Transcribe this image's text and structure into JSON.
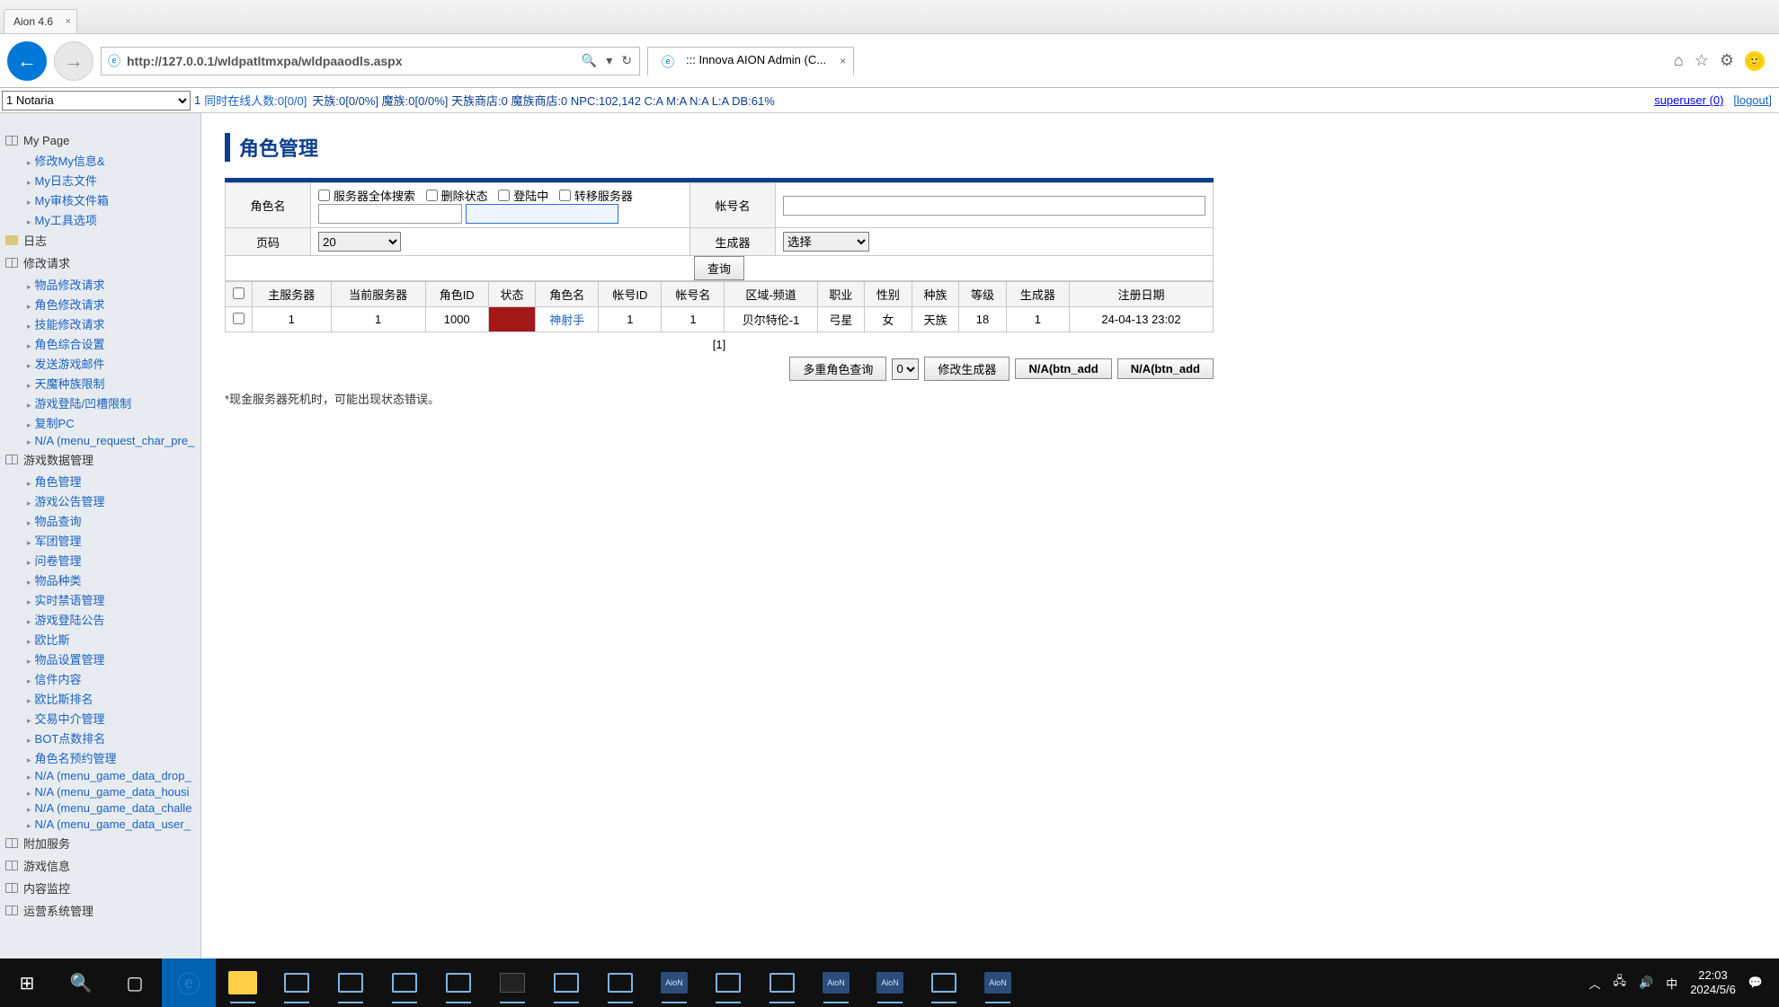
{
  "window": {
    "tab_title": "Aion 4.6"
  },
  "ie": {
    "address": "http://127.0.0.1/wldpatltmxpa/wldpaaodls.aspx",
    "tab_title": "::: Innova AION Admin (C..."
  },
  "status": {
    "server_selected": "1 Notaria",
    "num_before": "1",
    "online_label": "同时在线人数:0[0/0]",
    "rest": "天族:0[0/0%] 魔族:0[0/0%] 天族商店:0 魔族商店:0 NPC:102,142 C:A M:A N:A L:A DB:61%",
    "user": "superuser (0)",
    "logout": "[logout]"
  },
  "sidebar": {
    "sec_mypage": "My Page",
    "mypage": [
      "修改My信息&",
      "My日志文件",
      "My审核文件箱",
      "My工具选项"
    ],
    "sec_log": "日志",
    "sec_modify": "修改请求",
    "modify": [
      "物品修改请求",
      "角色修改请求",
      "技能修改请求",
      "角色综合设置",
      "发送游戏邮件",
      "天魔种族限制",
      "游戏登陆/凹槽限制",
      "复制PC",
      "N/A (menu_request_char_pre_"
    ],
    "sec_game": "游戏数据管理",
    "game": [
      "角色管理",
      "游戏公告管理",
      "物品查询",
      "军团管理",
      "问卷管理",
      "物品种类",
      "实时禁语管理",
      "游戏登陆公告",
      "欧比斯",
      "物品设置管理",
      "信件内容",
      "欧比斯排名",
      "交易中介管理",
      "BOT点数排名",
      "角色名预约管理",
      "N/A (menu_game_data_drop_",
      "N/A (menu_game_data_housi",
      "N/A (menu_game_data_challe",
      "N/A (menu_game_data_user_"
    ],
    "sec_addon": "附加服务",
    "sec_info": "游戏信息",
    "sec_monitor": "内容监控",
    "sec_ops": "运营系统管理"
  },
  "page": {
    "title": "角色管理",
    "filters": {
      "role_name": "角色名",
      "cb_all_servers": "服务器全体搜索",
      "cb_del_state": "删除状态",
      "cb_logging_in": "登陆中",
      "cb_transfer": "转移服务器",
      "account_name": "帐号名",
      "page_size_label": "页码",
      "page_size_value": "20",
      "generator_label": "生成器",
      "generator_value": "选择",
      "query_btn": "查询"
    },
    "table": {
      "headers": [
        "",
        "主服务器",
        "当前服务器",
        "角色ID",
        "状态",
        "角色名",
        "帐号ID",
        "帐号名",
        "区域-频道",
        "职业",
        "性别",
        "种族",
        "等级",
        "生成器",
        "注册日期"
      ],
      "row": {
        "main_server": "1",
        "cur_server": "1",
        "role_id": "1000",
        "role_name": "神射手",
        "acct_id": "1",
        "acct_name": "1",
        "zone": "贝尔特伦-1",
        "job": "弓星",
        "sex": "女",
        "race": "天族",
        "level": "18",
        "gen": "1",
        "reg": "24-04-13 23:02"
      }
    },
    "pager": "[1]",
    "actions": {
      "multi_query": "多重角色查询",
      "dd_value": "0",
      "mod_gen": "修改生成器",
      "btn_add1": "N/A(btn_add",
      "btn_add2": "N/A(btn_add"
    },
    "note": "*现金服务器死机时，可能出现状态错误。"
  },
  "taskbar": {
    "time": "22:03",
    "date": "2024/5/6",
    "ime": "中",
    "aion_label": "AioN"
  }
}
